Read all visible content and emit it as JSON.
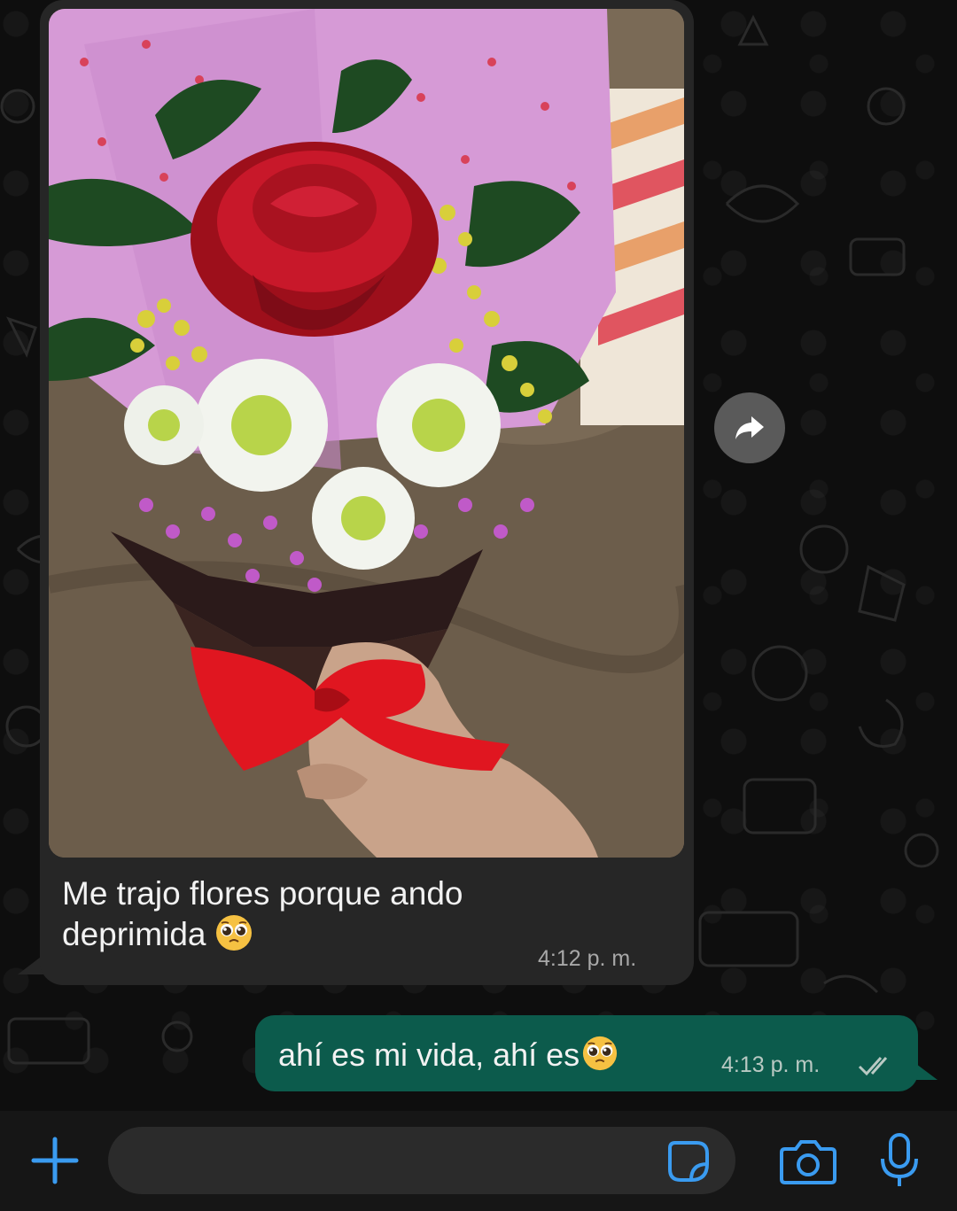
{
  "chat": {
    "incoming": {
      "image_description_icon": "bouquet-photo",
      "caption": "Me trajo flores porque ando deprimida",
      "emoji": "pleading-face-emoji",
      "time": "4:12 p. m."
    },
    "outgoing": {
      "text": "ahí es mi vida, ahí es",
      "emoji": "pleading-face-emoji",
      "time": "4:13 p. m.",
      "status_icon": "double-check-icon"
    },
    "forward_icon": "forward-icon"
  },
  "composer": {
    "placeholder": "",
    "icons": [
      "plus-icon",
      "sticker-icon",
      "camera-icon",
      "mic-icon"
    ],
    "accent_color": "#3a9bf0"
  },
  "colors": {
    "incoming_bubble": "#262626",
    "outgoing_bubble": "#0c5b4c",
    "background": "#0e0e0e"
  }
}
